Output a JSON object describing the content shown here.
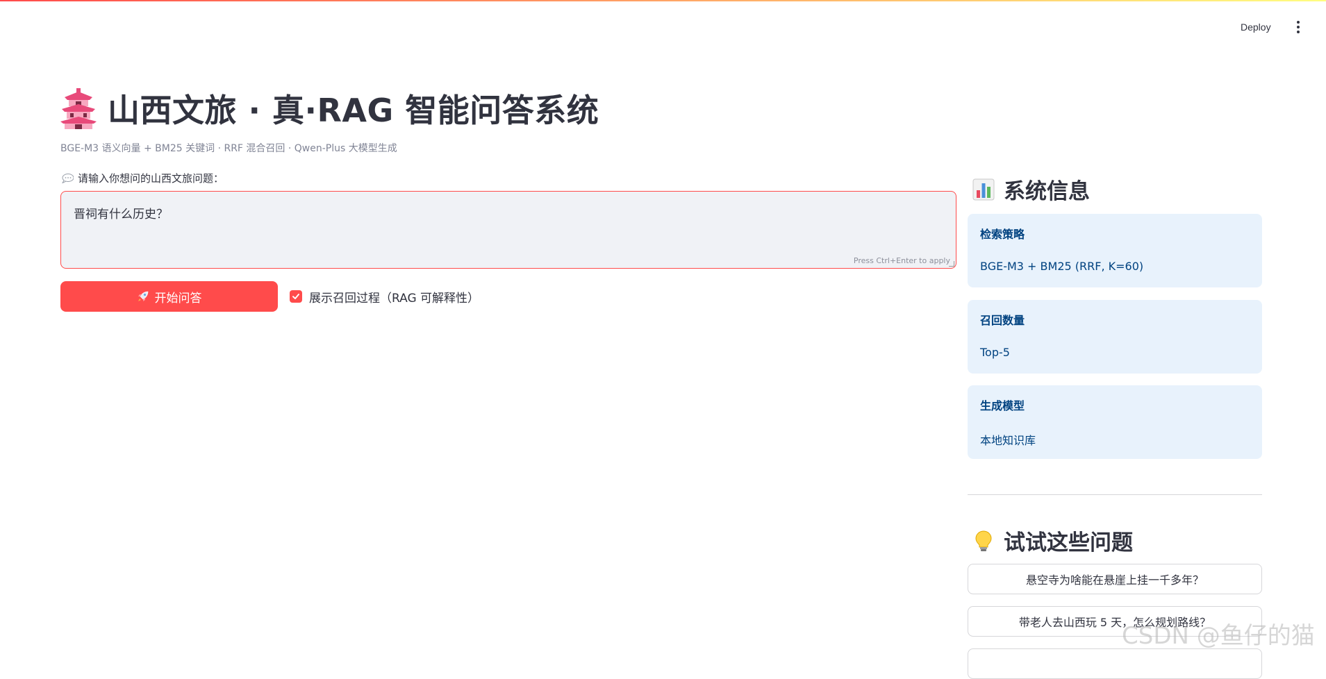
{
  "header": {
    "deploy_label": "Deploy"
  },
  "main": {
    "title": "山西文旅 · 真·RAG 智能问答系统",
    "title_icon": "pagoda-icon",
    "caption": "BGE-M3 语义向量 + BM25 关键词 · RRF 混合召回 · Qwen-Plus 大模型生成",
    "input_label": "请输入你想问的山西文旅问题：",
    "input_label_icon": "speech-bubble-icon",
    "question_value": "晋祠有什么历史？",
    "press_hint": "Press Ctrl+Enter to apply",
    "start_button_label": "开始问答",
    "start_button_icon": "rocket-icon",
    "show_recall_label": "展示召回过程（RAG 可解释性）",
    "show_recall_checked": true
  },
  "sidebar": {
    "system_heading": "系统信息",
    "system_icon": "bar-chart-icon",
    "cards": [
      {
        "title": "检索策略",
        "value": "BGE-M3 + BM25 (RRF, K=60)"
      },
      {
        "title": "召回数量",
        "value": "Top-5"
      },
      {
        "title": "生成模型",
        "value": "本地知识库"
      }
    ],
    "try_heading": "试试这些问题",
    "try_icon": "light-bulb-icon",
    "questions": [
      "悬空寺为啥能在悬崖上挂一千多年？",
      "带老人去山西玩 5 天，怎么规划路线？"
    ]
  },
  "watermark": "CSDN @鱼仔的猫",
  "colors": {
    "primary": "#ff4b4b",
    "card_bg": "#e8f2fc",
    "card_text": "#004280",
    "input_bg": "#f0f2f6",
    "text": "#31333f",
    "muted": "#808495"
  }
}
